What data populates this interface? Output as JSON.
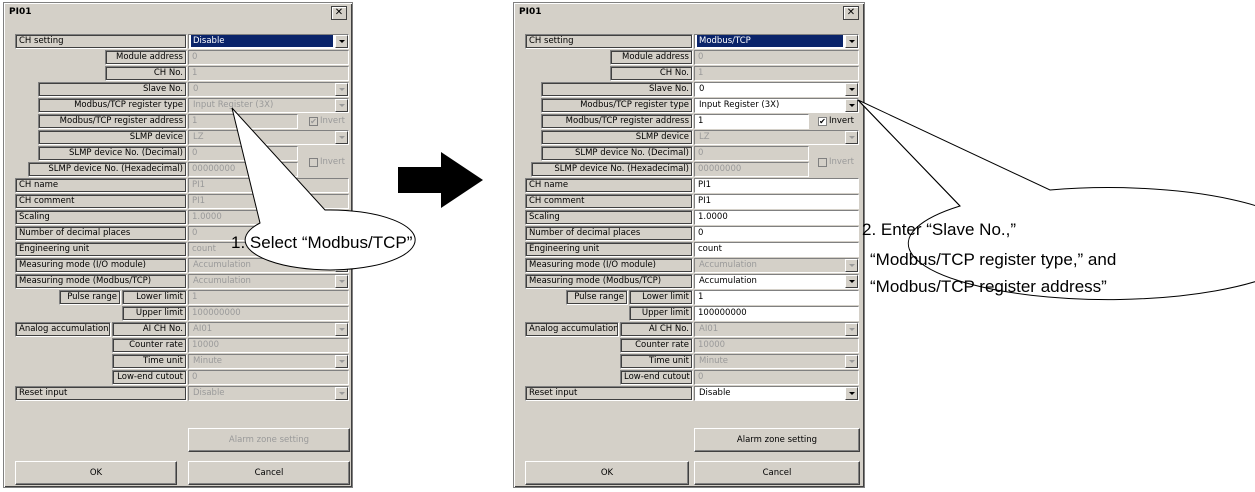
{
  "left_dialog": {
    "title": "PI01",
    "close_label": "✕",
    "rows": {
      "ch_setting": {
        "label": "CH setting",
        "value": "Disable"
      },
      "module_address": {
        "label": "Module address",
        "value": "0"
      },
      "ch_no": {
        "label": "CH No.",
        "value": "1"
      },
      "slave_no": {
        "label": "Slave No.",
        "value": "0"
      },
      "reg_type": {
        "label": "Modbus/TCP register type",
        "value": "Input Register (3X)"
      },
      "reg_address": {
        "label": "Modbus/TCP register address",
        "value": "1"
      },
      "invert1": {
        "label": "Invert"
      },
      "slmp_device": {
        "label": "SLMP device",
        "value": "LZ"
      },
      "slmp_dec": {
        "label": "SLMP device No. (Decimal)",
        "value": "0"
      },
      "slmp_hex": {
        "label": "SLMP device No. (Hexadecimal)",
        "value": "00000000"
      },
      "invert2": {
        "label": "Invert"
      },
      "ch_name": {
        "label": "CH name",
        "value": "PI1"
      },
      "ch_comment": {
        "label": "CH comment",
        "value": "PI1"
      },
      "scaling": {
        "label": "Scaling",
        "value": "1.0000"
      },
      "decimal_places": {
        "label": "Number of decimal places",
        "value": "0"
      },
      "eng_unit": {
        "label": "Engineering unit",
        "value": "count"
      },
      "meas_io": {
        "label": "Measuring mode (I/O module)",
        "value": "Accumulation"
      },
      "meas_tcp": {
        "label": "Measuring mode (Modbus/TCP)",
        "value": "Accumulation"
      },
      "pulse_range": {
        "label": "Pulse range"
      },
      "lower_limit": {
        "label": "Lower limit",
        "value": "1"
      },
      "upper_limit": {
        "label": "Upper limit",
        "value": "100000000"
      },
      "analog_acc": {
        "label": "Analog accumulation"
      },
      "ai_ch_no": {
        "label": "AI CH No.",
        "value": "AI01"
      },
      "counter_rate": {
        "label": "Counter rate",
        "value": "10000"
      },
      "time_unit": {
        "label": "Time unit",
        "value": "Minute"
      },
      "low_cutout": {
        "label": "Low-end cutout",
        "value": "0"
      },
      "reset_input": {
        "label": "Reset input",
        "value": "Disable"
      }
    },
    "alarm_button": "Alarm zone setting",
    "ok_button": "OK",
    "cancel_button": "Cancel"
  },
  "right_dialog": {
    "title": "PI01",
    "close_label": "✕",
    "rows": {
      "ch_setting": {
        "label": "CH setting",
        "value": "Modbus/TCP"
      },
      "module_address": {
        "label": "Module address",
        "value": "0"
      },
      "ch_no": {
        "label": "CH No.",
        "value": "1"
      },
      "slave_no": {
        "label": "Slave No.",
        "value": "0"
      },
      "reg_type": {
        "label": "Modbus/TCP register type",
        "value": "Input Register (3X)"
      },
      "reg_address": {
        "label": "Modbus/TCP register address",
        "value": "1"
      },
      "invert1": {
        "label": "Invert"
      },
      "slmp_device": {
        "label": "SLMP device",
        "value": "LZ"
      },
      "slmp_dec": {
        "label": "SLMP device No. (Decimal)",
        "value": "0"
      },
      "slmp_hex": {
        "label": "SLMP device No. (Hexadecimal)",
        "value": "00000000"
      },
      "invert2": {
        "label": "Invert"
      },
      "ch_name": {
        "label": "CH name",
        "value": "PI1"
      },
      "ch_comment": {
        "label": "CH comment",
        "value": "PI1"
      },
      "scaling": {
        "label": "Scaling",
        "value": "1.0000"
      },
      "decimal_places": {
        "label": "Number of decimal places",
        "value": "0"
      },
      "eng_unit": {
        "label": "Engineering unit",
        "value": "count"
      },
      "meas_io": {
        "label": "Measuring mode (I/O module)",
        "value": "Accumulation"
      },
      "meas_tcp": {
        "label": "Measuring mode (Modbus/TCP)",
        "value": "Accumulation"
      },
      "pulse_range": {
        "label": "Pulse range"
      },
      "lower_limit": {
        "label": "Lower limit",
        "value": "1"
      },
      "upper_limit": {
        "label": "Upper limit",
        "value": "100000000"
      },
      "analog_acc": {
        "label": "Analog accumulation"
      },
      "ai_ch_no": {
        "label": "AI CH No.",
        "value": "AI01"
      },
      "counter_rate": {
        "label": "Counter rate",
        "value": "10000"
      },
      "time_unit": {
        "label": "Time unit",
        "value": "Minute"
      },
      "low_cutout": {
        "label": "Low-end cutout",
        "value": "0"
      },
      "reset_input": {
        "label": "Reset input",
        "value": "Disable"
      }
    },
    "alarm_button": "Alarm zone setting",
    "ok_button": "OK",
    "cancel_button": "Cancel"
  },
  "annotations": {
    "step1": "1. Select “Modbus/TCP”",
    "step2_line1": "2. Enter “Slave No.,”",
    "step2_line2": "“Modbus/TCP register type,” and",
    "step2_line3": "“Modbus/TCP register address”"
  },
  "colors": {
    "dialog_bg": "#d4d0c8",
    "selection": "#0a246a",
    "disabled_text": "#9a9a9a"
  }
}
